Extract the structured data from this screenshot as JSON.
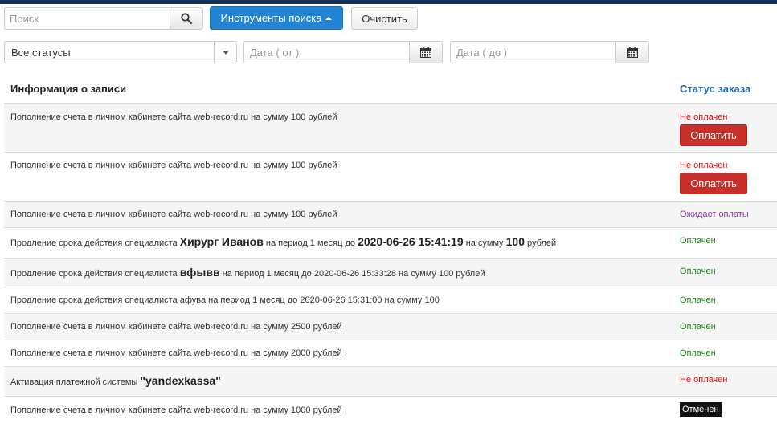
{
  "toolbar": {
    "search_placeholder": "Поиск",
    "search_tools_label": "Инструменты поиска",
    "clear_label": "Очистить",
    "status_filter_value": "Все статусы",
    "date_from_placeholder": "Дата ( от )",
    "date_to_placeholder": "Дата ( до )"
  },
  "table": {
    "col_info": "Информация о записи",
    "col_status": "Статус заказа",
    "pay_label": "Оплатить",
    "rows": [
      {
        "info": "Пополнение счета в личном кабинете сайта web-record.ru на сумму 100 рублей",
        "status": "Не оплачен"
      },
      {
        "info": "Пополнение счета в личном кабинете сайта web-record.ru на сумму 100 рублей",
        "status": "Не оплачен"
      },
      {
        "info": "Пополнение счета в личном кабинете сайта web-record.ru на сумму 100 рублей",
        "status": "Ожидает оплаты"
      },
      {
        "info_p1": "Продление срока действия специалиста",
        "info_name": "Хирург Иванов",
        "info_p2": "на период 1 месяц до",
        "info_date": "2020-06-26 15:41:19",
        "info_p3": "на сумму",
        "info_sum": "100",
        "info_p4": "рублей",
        "status": "Оплачен"
      },
      {
        "info_p1": "Продление срока действия специалиста",
        "info_name": "вфывв",
        "info_p2": "на период 1 месяц до 2020-06-26 15:33:28 на сумму 100 рублей",
        "status": "Оплачен"
      },
      {
        "info": "Продление срока действия специалиста афува на период 1 месяц до 2020-06-26 15:31:00 на сумму 100",
        "status": "Оплачен"
      },
      {
        "info": "Пополнение счета в личном кабинете сайта web-record.ru на сумму 2500 рублей",
        "status": "Оплачен"
      },
      {
        "info": "Пополнение счета в личном кабинете сайта web-record.ru на сумму 2000 рублей",
        "status": "Оплачен"
      },
      {
        "info_p1": "Активация платежной системы",
        "info_name": "\"yandexkassa\"",
        "status": "Не оплачен"
      },
      {
        "info": "Пополнение счета в личном кабинете сайта web-record.ru на сумму 1000 рублей",
        "status": "Отменен"
      }
    ]
  },
  "colors": {
    "primary": "#2384d3",
    "danger": "#c9302c",
    "unpaid": "#dd1111",
    "paid": "#1a8a1a",
    "awaiting": "#8a3e9a",
    "topbar": "#17325a"
  },
  "icons": {
    "search": "search-icon",
    "calendar": "calendar-icon",
    "caret_up": "caret-up-icon",
    "caret_down": "chevron-down-icon"
  }
}
